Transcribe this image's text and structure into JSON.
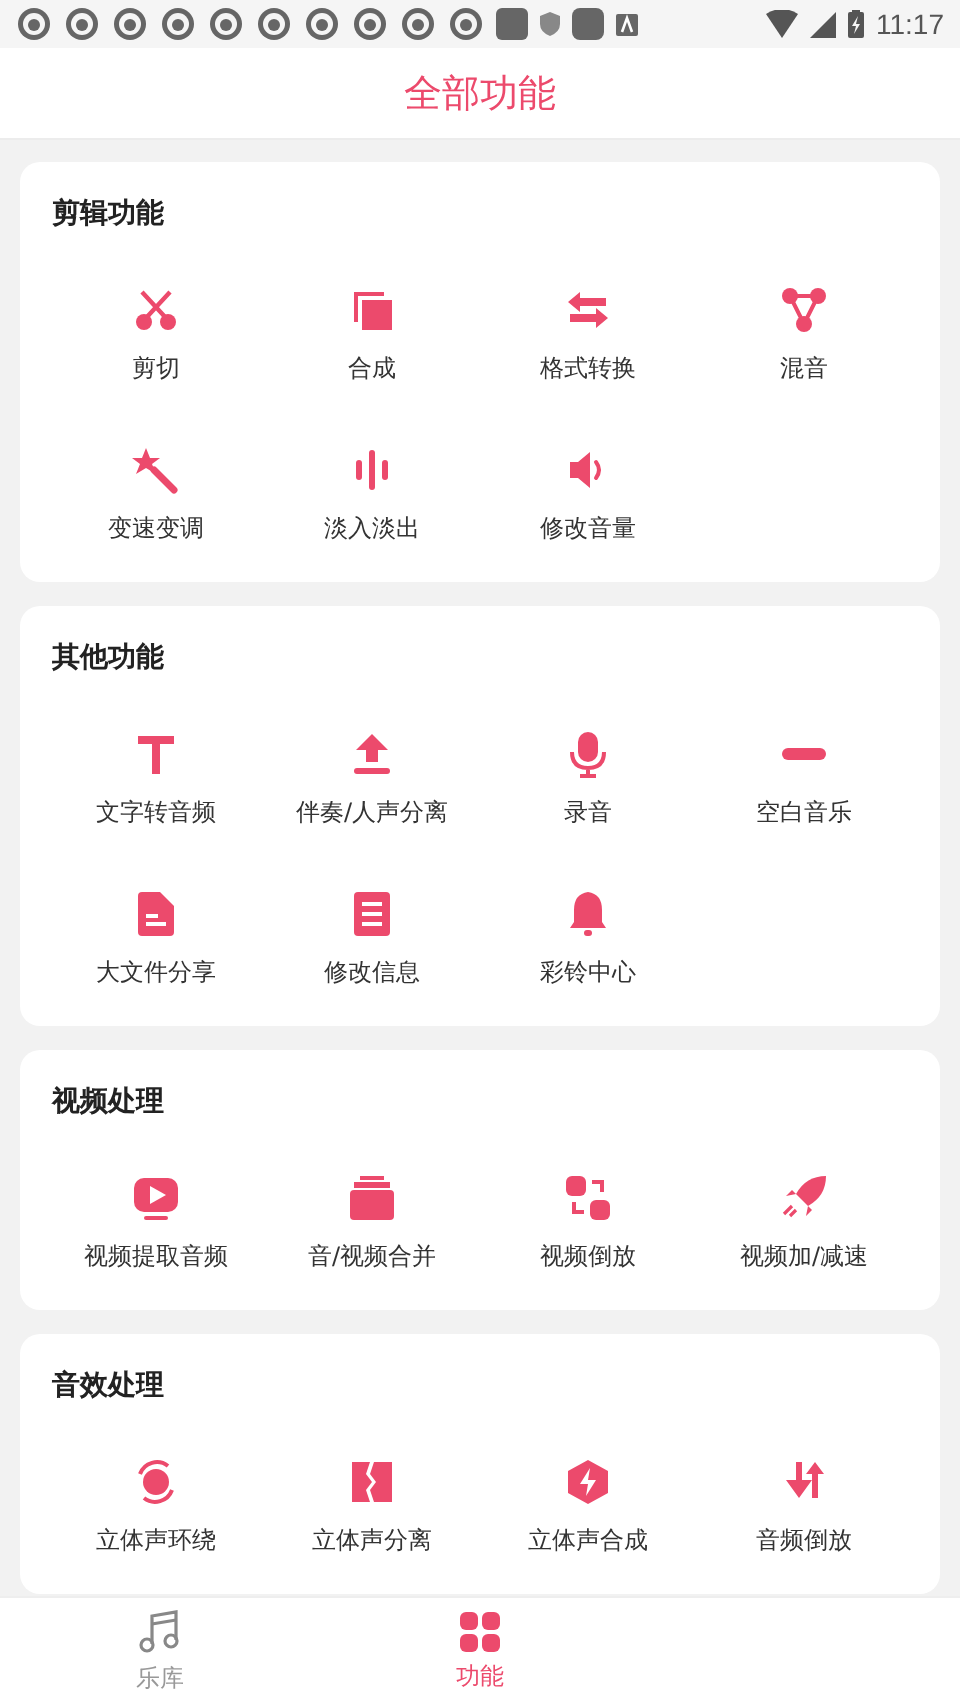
{
  "status_bar": {
    "time": "11:17"
  },
  "title": "全部功能",
  "sections": [
    {
      "title": "剪辑功能",
      "items": [
        "剪切",
        "合成",
        "格式转换",
        "混音",
        "变速变调",
        "淡入淡出",
        "修改音量"
      ]
    },
    {
      "title": "其他功能",
      "items": [
        "文字转音频",
        "伴奏/人声分离",
        "录音",
        "空白音乐",
        "大文件分享",
        "修改信息",
        "彩铃中心"
      ]
    },
    {
      "title": "视频处理",
      "items": [
        "视频提取音频",
        "音/视频合并",
        "视频倒放",
        "视频加/减速"
      ]
    },
    {
      "title": "音效处理",
      "items": [
        "立体声环绕",
        "立体声分离",
        "立体声合成",
        "音频倒放"
      ]
    }
  ],
  "tabs": [
    {
      "label": "乐库",
      "selected": false
    },
    {
      "label": "功能",
      "selected": true
    }
  ]
}
